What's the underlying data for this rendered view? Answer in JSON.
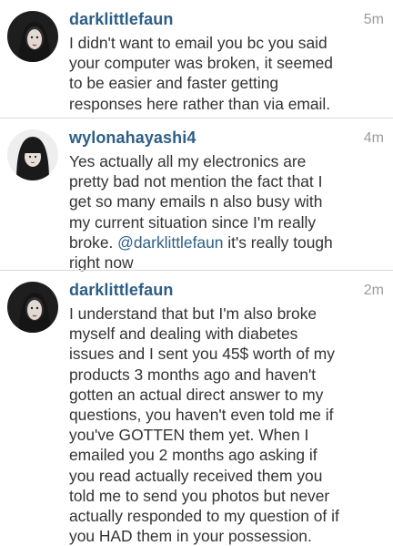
{
  "comments": [
    {
      "username": "darklittlefaun",
      "time": "5m",
      "avatar": "dark-hair-portrait",
      "text": "I didn't want to email you bc you said\nyour computer was broken, it seemed\nto be easier and faster getting\nresponses here rather than via email."
    },
    {
      "username": "wylonahayashi4",
      "time": "4m",
      "avatar": "dark-hair-portrait",
      "text_before": "Yes actually all my electronics are\npretty bad not mention the fact that I\nget so many emails n also busy with\nmy current situation since I'm really\nbroke. ",
      "mention": "@darklittlefaun",
      "text_after": " it's really tough\nright now"
    },
    {
      "username": "darklittlefaun",
      "time": "2m",
      "avatar": "dark-hair-portrait",
      "text": "I understand that but I'm also broke\nmyself and dealing with diabetes\nissues and I sent you 45$ worth of my\nproducts 3 months ago and haven't\ngotten an actual direct answer to my\nquestions, you haven't even told me if\nyou've GOTTEN them yet. When I\nemailed you 2 months ago asking if\nyou read actually received them you\ntold me to send you photos but never\nactually responded to my question of if\nyou HAD them in your possession."
    }
  ],
  "colors": {
    "username": "#2d5f86",
    "text": "#333333",
    "time": "#9b9b9b",
    "divider": "#d9d9d9"
  }
}
